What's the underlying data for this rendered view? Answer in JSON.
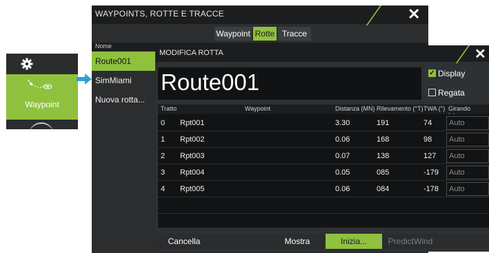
{
  "sidebar": {
    "label": "Waypoint",
    "icons": {
      "settings": "gear-icon",
      "waypoint": "waypoint-icon",
      "arrow": "arrow-right-icon"
    }
  },
  "back_dialog": {
    "title": "WAYPOINTS, ROTTE E TRACCE",
    "tabs": [
      "Waypoint",
      "Rotte",
      "Tracce"
    ],
    "list_header": "Nome",
    "routes": [
      "Route001",
      "SimMiami",
      "Nuova rotta..."
    ]
  },
  "front_dialog": {
    "title": "MODIFICA ROTTA",
    "route_name": "Route001",
    "checkboxes": [
      {
        "label": "Display",
        "checked": true
      },
      {
        "label": "Regata",
        "checked": false
      }
    ],
    "columns": [
      "Tratto",
      "Waypoint",
      "Distanza (MN)",
      "Rilevamento (°T)",
      "TWA (°)",
      "Girando Intorno"
    ],
    "rows": [
      {
        "tratto": "0",
        "waypoint": "Rpt001",
        "distanza": "3.30",
        "rilevamento": "191",
        "twa": "74",
        "girando": "Auto"
      },
      {
        "tratto": "1",
        "waypoint": "Rpt002",
        "distanza": "0.06",
        "rilevamento": "168",
        "twa": "98",
        "girando": "Auto"
      },
      {
        "tratto": "2",
        "waypoint": "Rpt003",
        "distanza": "0.07",
        "rilevamento": "138",
        "twa": "127",
        "girando": "Auto"
      },
      {
        "tratto": "3",
        "waypoint": "Rpt004",
        "distanza": "0.05",
        "rilevamento": "085",
        "twa": "-179",
        "girando": "Auto"
      },
      {
        "tratto": "4",
        "waypoint": "Rpt005",
        "distanza": "0.06",
        "rilevamento": "084",
        "twa": "-178",
        "girando": "Auto"
      }
    ],
    "buttons": [
      "Cancella",
      "Mostra",
      "Inizia...",
      "PredictWind"
    ]
  },
  "colors": {
    "accent": "#8fc13e",
    "panel": "#2e3133",
    "dark": "#121314"
  }
}
